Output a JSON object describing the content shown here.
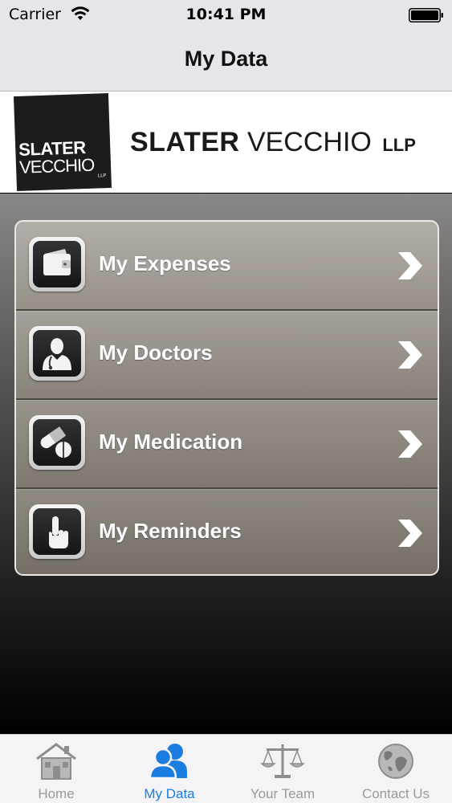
{
  "status_bar": {
    "carrier": "Carrier",
    "time": "10:41 PM"
  },
  "nav": {
    "title": "My Data"
  },
  "banner": {
    "logo_square_line1": "SLATER",
    "logo_square_line2": "VECCHIO",
    "logo_square_line3": "LLP",
    "wordmark_bold": "SLATER",
    "wordmark_light": "VECCHIO",
    "wordmark_suffix": "LLP"
  },
  "menu": {
    "items": [
      {
        "label": "My Expenses",
        "icon": "wallet-icon"
      },
      {
        "label": "My Doctors",
        "icon": "doctor-icon"
      },
      {
        "label": "My Medication",
        "icon": "pills-icon"
      },
      {
        "label": "My Reminders",
        "icon": "touch-finger-icon"
      }
    ]
  },
  "tabs": [
    {
      "label": "Home",
      "icon": "home-icon",
      "active": false
    },
    {
      "label": "My Data",
      "icon": "people-icon",
      "active": true
    },
    {
      "label": "Your Team",
      "icon": "scales-icon",
      "active": false
    },
    {
      "label": "Contact Us",
      "icon": "globe-icon",
      "active": false
    }
  ],
  "colors": {
    "tab_active": "#1b7de0",
    "tab_inactive": "#9a9a9a",
    "bar_background": "#e6e5ea"
  }
}
